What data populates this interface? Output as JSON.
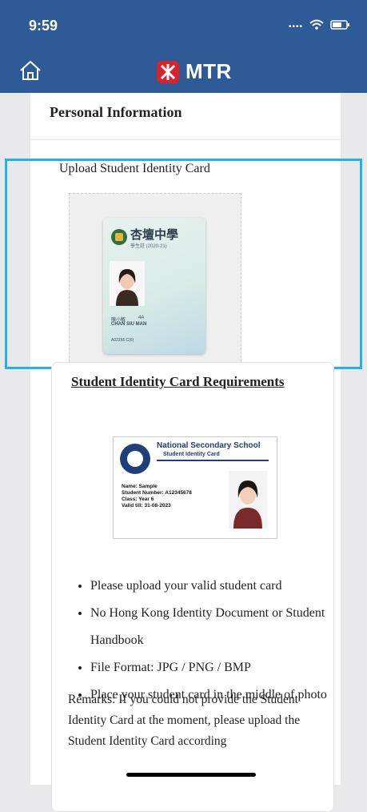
{
  "status": {
    "time": "9:59",
    "signal_icon": "dots-signal-icon",
    "wifi_icon": "wifi-icon",
    "battery_icon": "battery-icon"
  },
  "nav": {
    "home_icon": "home-icon",
    "brand_name": "MTR"
  },
  "personal": {
    "title": "Personal Information"
  },
  "upload": {
    "label": "Upload Student Identity Card",
    "card": {
      "school_name_cn": "杏壇中學",
      "subtitle": "學生証 (2020-21)",
      "name_cn": "陳小敏",
      "class": "4A",
      "name_en": "CHAN SIU MAN",
      "card_no": "A02256 C(6)"
    }
  },
  "requirements": {
    "title": "Student Identity Card Requirements",
    "sample_card": {
      "school_name": "National Secondary School",
      "subtitle": "Student Identity Card",
      "name": "Name: Sample",
      "student_number": "Student Number: A12345678",
      "class": "Class: Year 6",
      "valid_till": "Valid till: 31-08-2023"
    },
    "bullets": [
      "Please upload your valid student card",
      "No Hong Kong Identity Document or Student Handbook",
      "File Format: JPG / PNG / BMP",
      "Place your student card in the middle of photo"
    ],
    "remarks": "Remarks: If you could not provide the Student Identity Card at the moment, please upload the Student Identity Card according"
  },
  "colors": {
    "header_blue": "#2e5a96",
    "highlight_cyan": "#1fb3e6",
    "brand_red": "#d8232a"
  }
}
